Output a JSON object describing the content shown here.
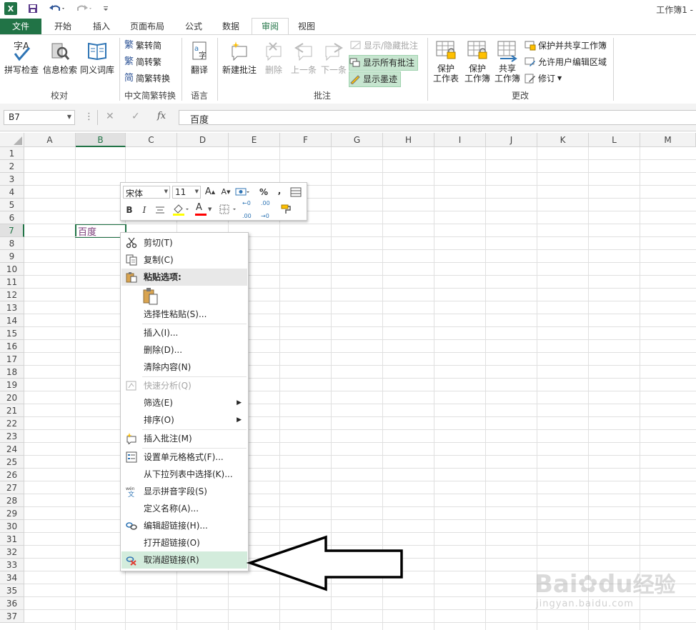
{
  "title_bar": {
    "logo": "X",
    "doc_title": "工作簿1 -"
  },
  "tabs": [
    "文件",
    "开始",
    "插入",
    "页面布局",
    "公式",
    "数据",
    "审阅",
    "视图"
  ],
  "active_tab": "审阅",
  "ribbon": {
    "proofing": {
      "spell": "拼写检查",
      "research": "信息检索",
      "thesaurus": "同义词库",
      "label": "校对"
    },
    "chinese": {
      "to_trad": "繁转简",
      "to_simp": "简转繁",
      "convert": "简繁转换",
      "label": "中文简繁转换"
    },
    "language": {
      "translate": "翻译",
      "label": "语言"
    },
    "comments": {
      "new": "新建批注",
      "delete": "删除",
      "prev": "上一条",
      "next": "下一条",
      "show_hide": "显示/隐藏批注",
      "show_all": "显示所有批注",
      "show_ink": "显示墨迹",
      "label": "批注"
    },
    "changes": {
      "protect_sheet_1": "保护",
      "protect_sheet_2": "工作表",
      "protect_wb_1": "保护",
      "protect_wb_2": "工作簿",
      "share_wb_1": "共享",
      "share_wb_2": "工作簿",
      "protect_share": "保护并共享工作簿",
      "allow_edit": "允许用户编辑区域",
      "track": "修订",
      "label": "更改"
    }
  },
  "formula_bar": {
    "name_box": "B7",
    "fx": "fx",
    "content": "百度"
  },
  "columns": [
    "A",
    "B",
    "C",
    "D",
    "E",
    "F",
    "G",
    "H",
    "I",
    "J",
    "K",
    "L",
    "M"
  ],
  "rows": [
    "1",
    "2",
    "3",
    "4",
    "5",
    "6",
    "7",
    "8",
    "9",
    "10",
    "11",
    "12",
    "13",
    "14",
    "15",
    "16",
    "17",
    "18",
    "19",
    "20",
    "21",
    "22",
    "23",
    "24",
    "25",
    "26",
    "27",
    "28",
    "29",
    "30",
    "31",
    "32",
    "33",
    "34",
    "35",
    "36",
    "37"
  ],
  "active_cell": {
    "ref": "B7",
    "text": "百度"
  },
  "mini_toolbar": {
    "font": "宋体",
    "size": "11",
    "percent": "%",
    "comma": ",",
    "bold": "B",
    "italic": "I",
    "font_color": "A",
    "dec_inc": "←0 .00",
    "dec_dec": ".00 →0"
  },
  "context_menu": [
    {
      "label": "剪切(T)",
      "icon": "scissors-icon"
    },
    {
      "label": "复制(C)",
      "icon": "copy-icon"
    },
    {
      "label": "粘贴选项:",
      "icon": "paste-icon"
    },
    {
      "label": "选择性粘贴(S)...",
      "icon": ""
    },
    {
      "label": "插入(I)...",
      "icon": ""
    },
    {
      "label": "删除(D)...",
      "icon": ""
    },
    {
      "label": "清除内容(N)",
      "icon": ""
    },
    {
      "label": "快速分析(Q)",
      "icon": "quick-analysis-icon"
    },
    {
      "label": "筛选(E)",
      "icon": ""
    },
    {
      "label": "排序(O)",
      "icon": ""
    },
    {
      "label": "插入批注(M)",
      "icon": "insert-comment-icon"
    },
    {
      "label": "设置单元格格式(F)...",
      "icon": "format-cells-icon"
    },
    {
      "label": "从下拉列表中选择(K)...",
      "icon": ""
    },
    {
      "label": "显示拼音字段(S)",
      "icon": "phonetic-icon"
    },
    {
      "label": "定义名称(A)...",
      "icon": ""
    },
    {
      "label": "编辑超链接(H)...",
      "icon": "edit-hyperlink-icon"
    },
    {
      "label": "打开超链接(O)",
      "icon": ""
    },
    {
      "label": "取消超链接(R)",
      "icon": "remove-hyperlink-icon"
    }
  ],
  "phonetic_icon_text": "wén",
  "watermark": {
    "brand": "Bai",
    "brand2": "du",
    "cn": "经验",
    "url": "jingyan.baidu.com"
  }
}
